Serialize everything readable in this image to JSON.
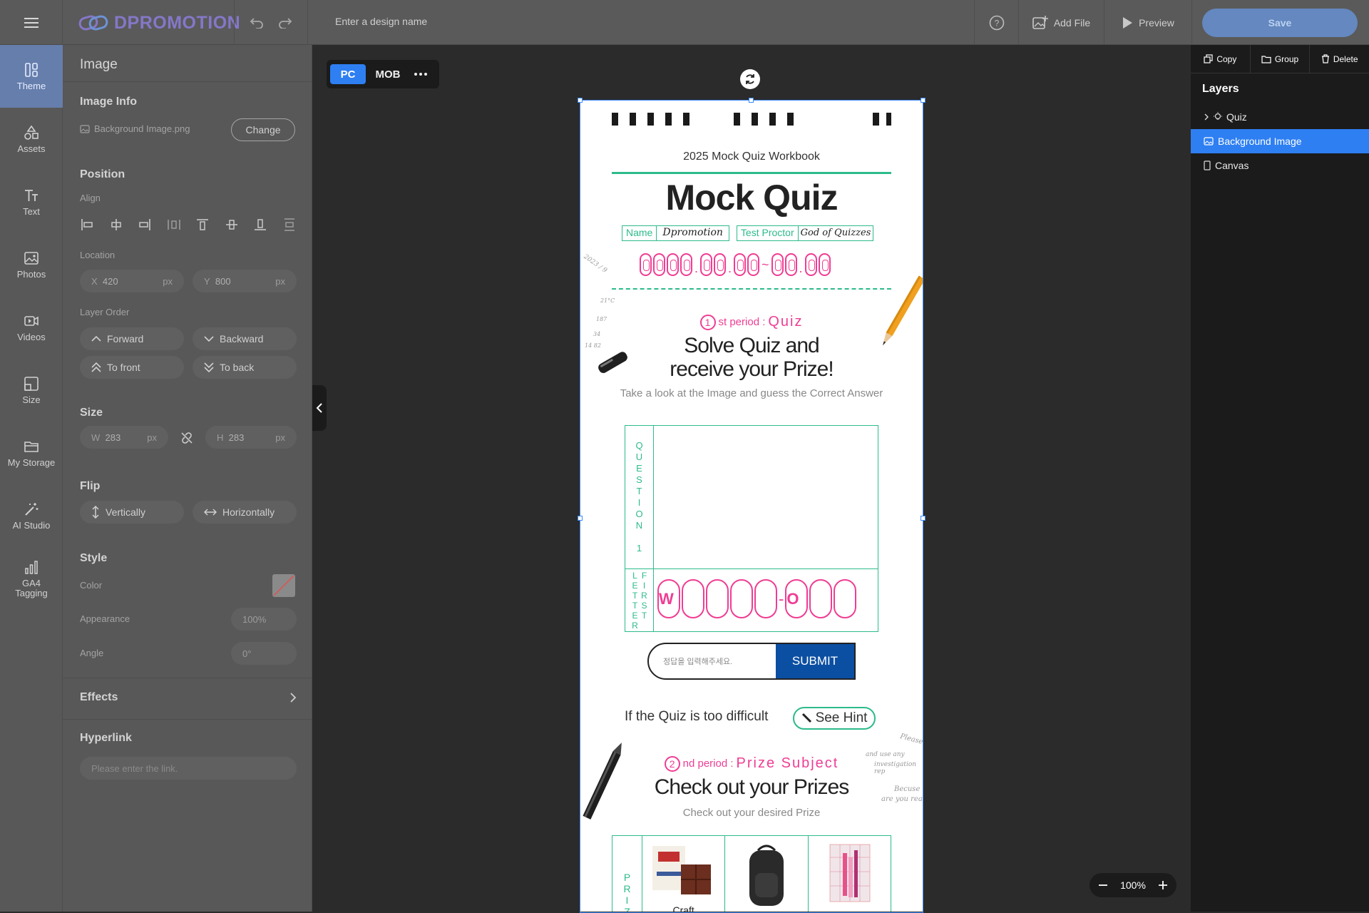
{
  "app": {
    "logo_text": "DPROMOTION",
    "design_name_placeholder": "Enter a design name"
  },
  "toolbar": {
    "add_file": "Add File",
    "preview": "Preview",
    "save": "Save"
  },
  "nav": [
    {
      "label": "Theme",
      "icon": "theme-icon"
    },
    {
      "label": "Assets",
      "icon": "assets-icon"
    },
    {
      "label": "Text",
      "icon": "text-icon"
    },
    {
      "label": "Photos",
      "icon": "photos-icon"
    },
    {
      "label": "Videos",
      "icon": "videos-icon"
    },
    {
      "label": "Size",
      "icon": "size-icon"
    },
    {
      "label": "My Storage",
      "icon": "folder-icon"
    },
    {
      "label": "AI Studio",
      "icon": "magic-wand-icon"
    },
    {
      "label": "GA4 Tagging",
      "icon": "chart-icon"
    }
  ],
  "props": {
    "title": "Image",
    "image_info": {
      "title": "Image Info",
      "file_name": "Background Image.png",
      "change": "Change"
    },
    "position": {
      "title": "Position",
      "align_label": "Align",
      "location_label": "Location",
      "x_label": "X",
      "x_value": "420",
      "x_unit": "px",
      "y_label": "Y",
      "y_value": "800",
      "y_unit": "px",
      "layer_order_label": "Layer Order",
      "forward": "Forward",
      "backward": "Backward",
      "to_front": "To front",
      "to_back": "To back"
    },
    "size": {
      "title": "Size",
      "w_label": "W",
      "w_value": "283",
      "w_unit": "px",
      "h_label": "H",
      "h_value": "283",
      "h_unit": "px"
    },
    "flip": {
      "title": "Flip",
      "vertically": "Vertically",
      "horizontally": "Horizontally"
    },
    "style": {
      "title": "Style",
      "color_label": "Color",
      "appearance_label": "Appearance",
      "appearance_value": "100%",
      "angle_label": "Angle",
      "angle_value": "0°"
    },
    "effects": {
      "title": "Effects"
    },
    "hyperlink": {
      "title": "Hyperlink",
      "placeholder": "Please enter the link."
    }
  },
  "canvas": {
    "pc": "PC",
    "mob": "MOB",
    "zoom": "100%"
  },
  "layers": {
    "copy": "Copy",
    "group": "Group",
    "delete": "Delete",
    "title": "Layers",
    "items": [
      {
        "label": "Quiz"
      },
      {
        "label": "Background Image"
      },
      {
        "label": "Canvas"
      }
    ]
  },
  "doc": {
    "workbook_title": "2025 Mock Quiz Workbook",
    "main_title": "Mock Quiz",
    "name_label": "Name",
    "name_value": "Dpromotion",
    "proctor_label": "Test Proctor",
    "proctor_value": "God of Quizzes",
    "period1_number": "1",
    "period1_suffix": "st period :",
    "period1_name": "Quiz",
    "headline1_line1": "Solve Quiz and",
    "headline1_line2": "receive your Prize!",
    "sub1": "Take a look at the Image and guess the Correct Answer",
    "question_label": "QUESTION 1",
    "first_letter_label": "FIRST LETTER",
    "answer_first_letter": "W",
    "answer_letter": "O",
    "answer_placeholder": "정답을 입력해주세요.",
    "submit": "SUBMIT",
    "hint_text": "If the Quiz is too difficult",
    "hint_button": "See Hint",
    "period2_number": "2",
    "period2_suffix": "nd period :",
    "period2_name": "Prize Subject",
    "headline2": "Check out your Prizes",
    "sub2": "Check out your desired Prize",
    "prize_label": "PRIZE",
    "prize1_caption": "Craft",
    "margin_notes": [
      "Please",
      "and use any",
      "investigation rep",
      "Becuse",
      "are you rea",
      "2023 / 9",
      "21°C",
      "187",
      "34",
      "14 82"
    ]
  }
}
